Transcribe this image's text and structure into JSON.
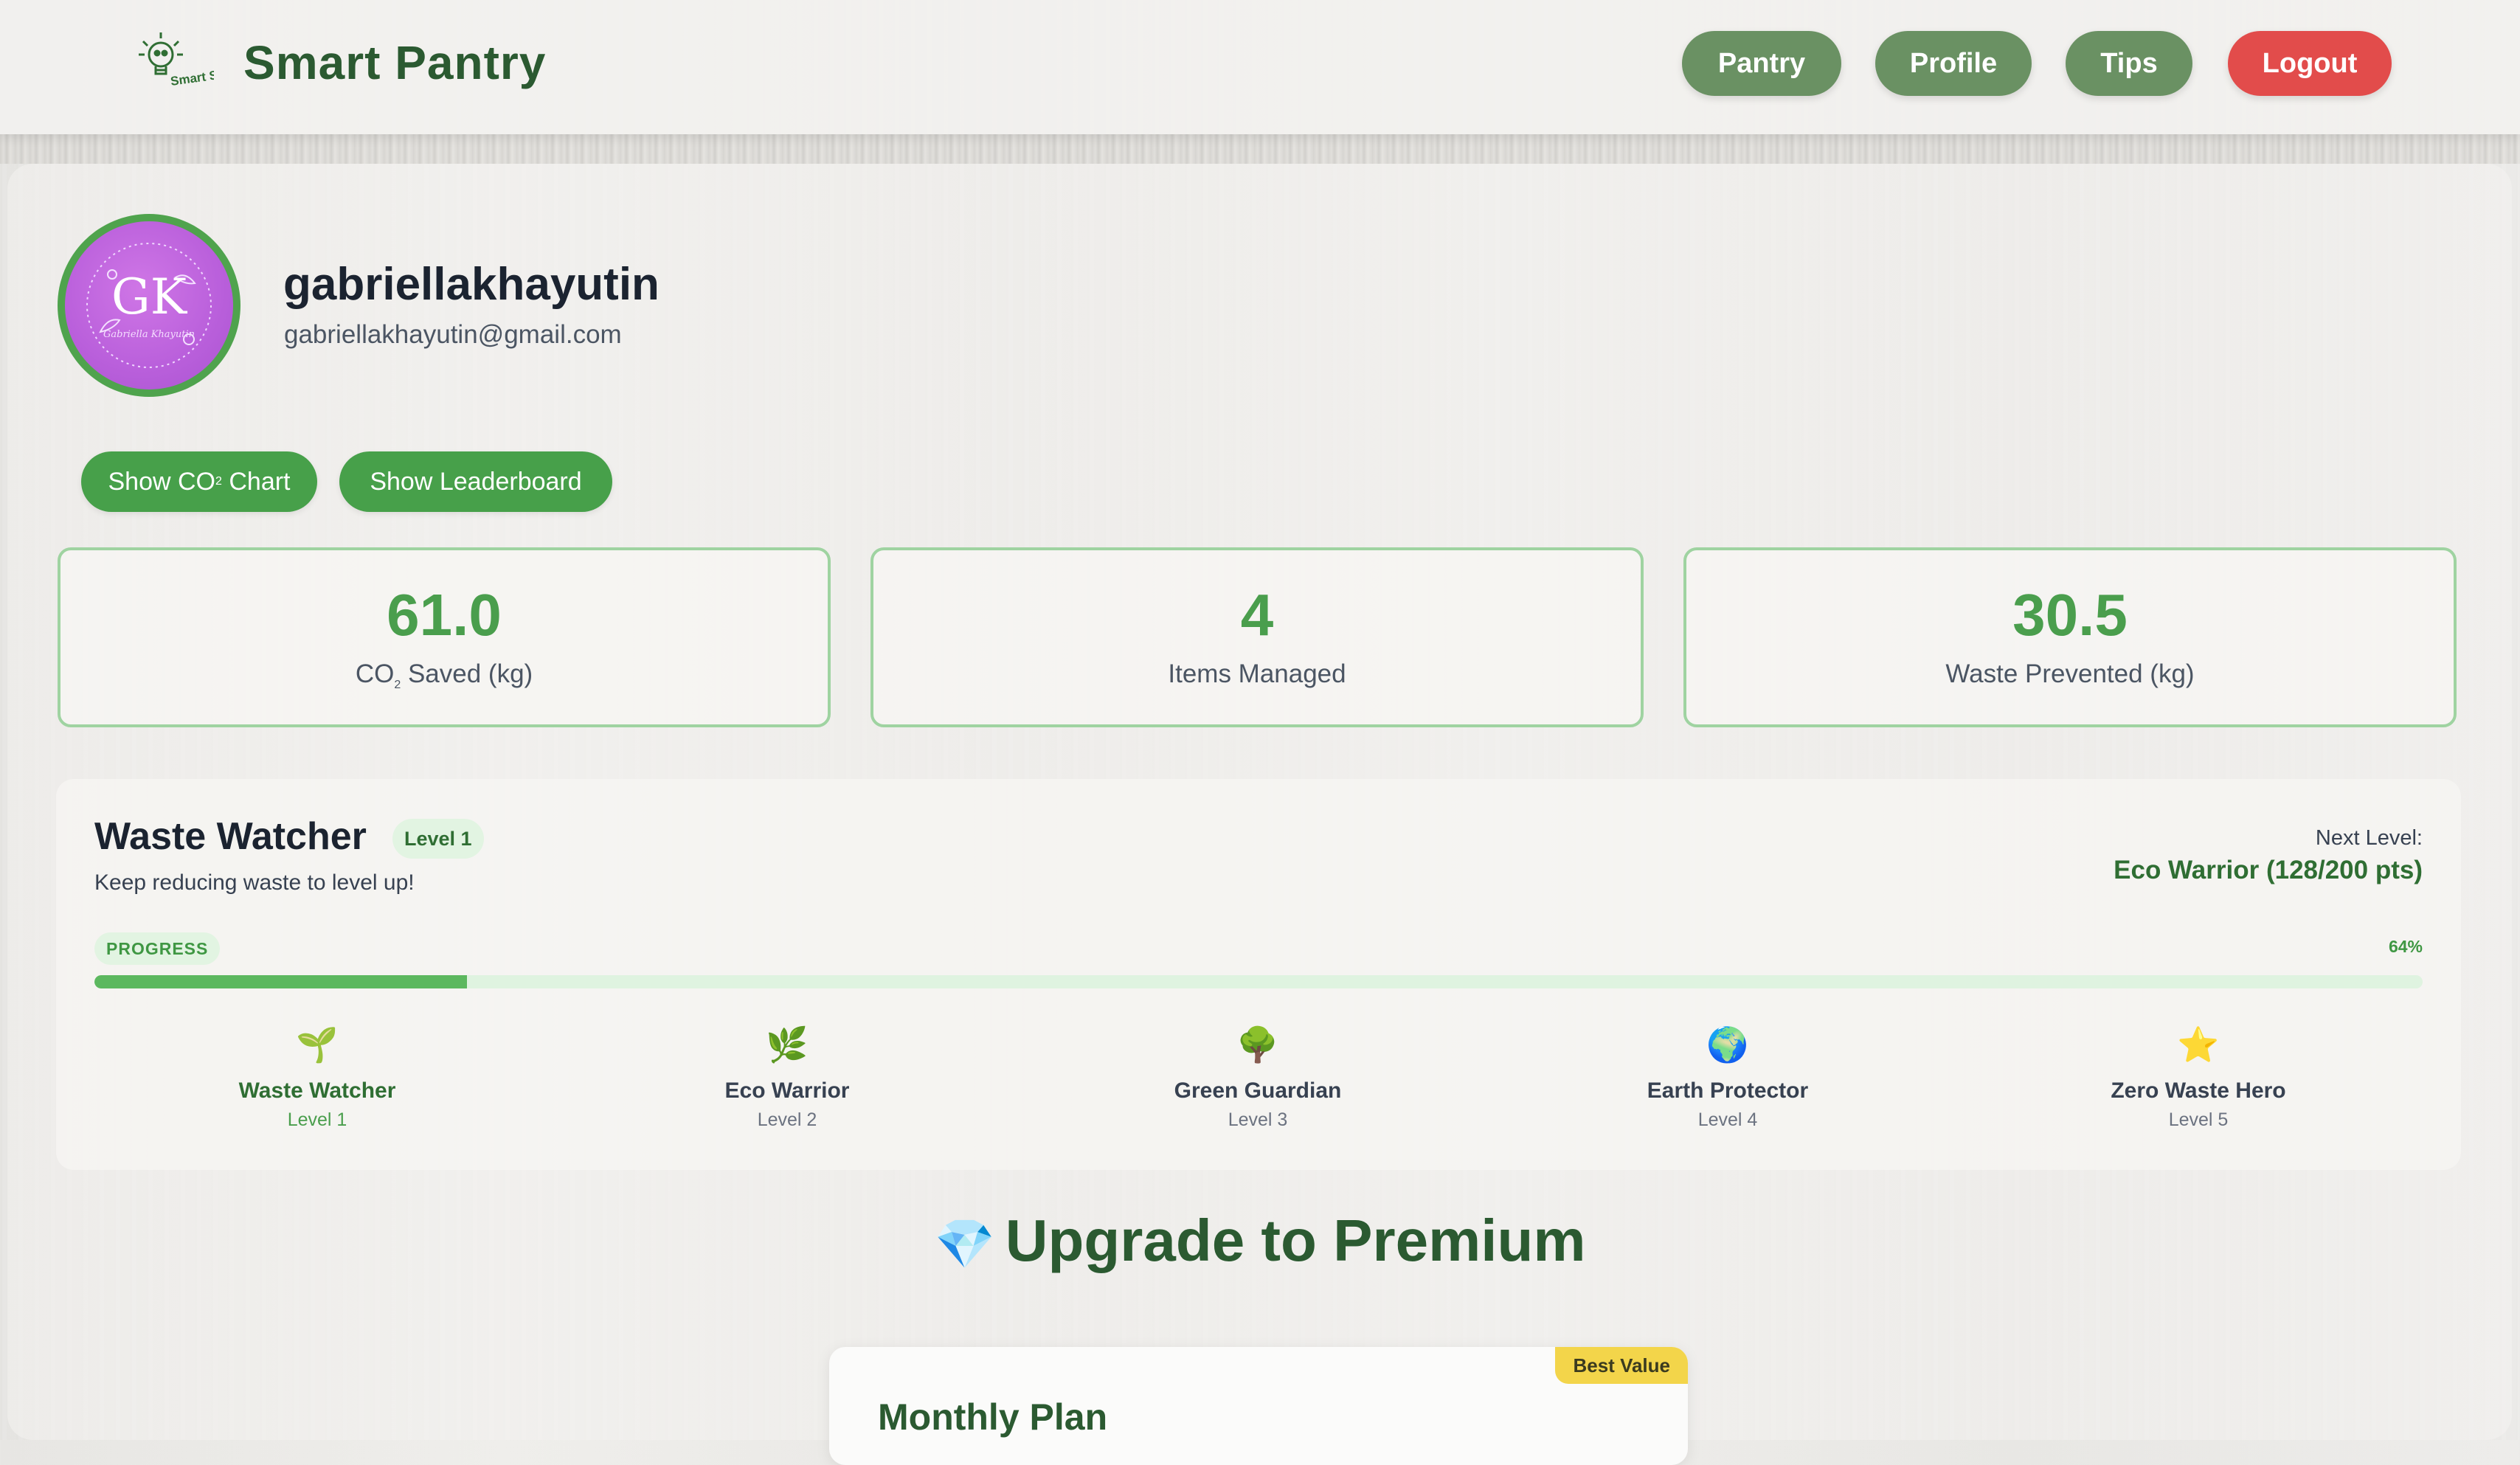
{
  "header": {
    "logo_text": "Smart Storage",
    "app_title": "Smart Pantry",
    "nav": [
      {
        "label": "Pantry",
        "color": "#6a9163"
      },
      {
        "label": "Profile",
        "color": "#6a9163"
      },
      {
        "label": "Tips",
        "color": "#6a9163"
      },
      {
        "label": "Logout",
        "color": "#e24c4b"
      }
    ]
  },
  "profile": {
    "avatar_initials": "GK",
    "avatar_script": "Gabriella Khayutin",
    "username": "gabriellakhayutin",
    "email": "gabriellakhayutin@gmail.com"
  },
  "actions": {
    "co2_chart_label": "Show CO",
    "co2_sub": "2",
    "co2_chart_suffix": " Chart",
    "leaderboard_label": "Show Leaderboard"
  },
  "stats": [
    {
      "value": "61.0",
      "label_prefix": "CO",
      "label_sub": "2",
      "label_suffix": " Saved (kg)"
    },
    {
      "value": "4",
      "label": "Items Managed"
    },
    {
      "value": "30.5",
      "label": "Waste Prevented (kg)"
    }
  ],
  "level": {
    "title": "Waste Watcher",
    "badge": "Level 1",
    "subtitle": "Keep reducing waste to level up!",
    "next_label": "Next Level:",
    "next_value": "Eco Warrior (128/200 pts)",
    "progress_tag": "PROGRESS",
    "progress_pct_text": "64%",
    "progress_fraction": 0.16,
    "accent": "#5cb85f",
    "levels": [
      {
        "icon": "seedling-icon",
        "glyph": "🌱",
        "name": "Waste Watcher",
        "num": "Level 1",
        "current": true
      },
      {
        "icon": "herb-icon",
        "glyph": "🌿",
        "name": "Eco Warrior",
        "num": "Level 2",
        "current": false
      },
      {
        "icon": "tree-icon",
        "glyph": "🌳",
        "name": "Green Guardian",
        "num": "Level 3",
        "current": false
      },
      {
        "icon": "globe-icon",
        "glyph": "🌍",
        "name": "Earth Protector",
        "num": "Level 4",
        "current": false
      },
      {
        "icon": "star-icon",
        "glyph": "⭐",
        "name": "Zero Waste Hero",
        "num": "Level 5",
        "current": false
      }
    ]
  },
  "premium": {
    "icon": "gem-icon",
    "glyph": "💎",
    "title": "Upgrade to Premium",
    "plan_name": "Monthly Plan",
    "plan_badge": "Best Value"
  }
}
